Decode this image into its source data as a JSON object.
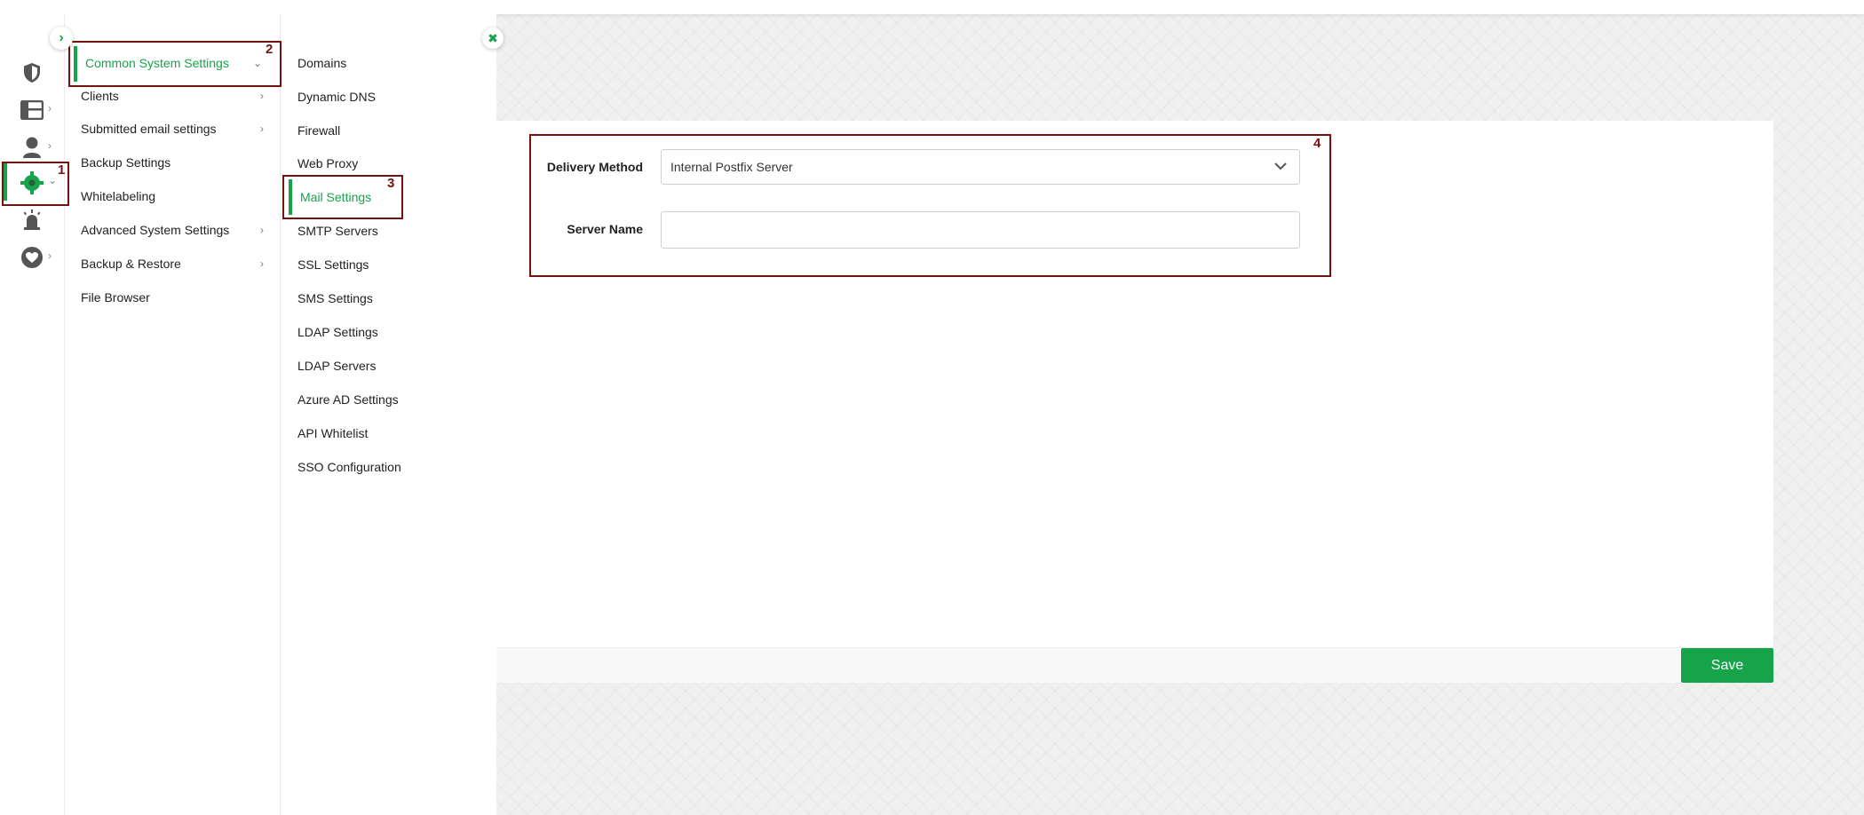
{
  "colors": {
    "accent": "#16a34a",
    "highlight": "#7a1111"
  },
  "rail": {
    "items": [
      {
        "icon": "shield-icon",
        "has_arrow": false
      },
      {
        "icon": "dashboard-icon",
        "has_arrow": true
      },
      {
        "icon": "user-icon",
        "has_arrow": true
      },
      {
        "icon": "settings-gear-icon",
        "has_arrow": true,
        "active": true
      },
      {
        "icon": "alarm-icon",
        "has_arrow": false
      },
      {
        "icon": "heart-icon",
        "has_arrow": true
      }
    ]
  },
  "menu1": {
    "items": [
      {
        "label": "Common System Settings",
        "arrow": "⌄",
        "active": true
      },
      {
        "label": "Clients",
        "arrow": "›"
      },
      {
        "label": "Submitted email settings",
        "arrow": "›"
      },
      {
        "label": "Backup Settings",
        "arrow": ""
      },
      {
        "label": "Whitelabeling",
        "arrow": ""
      },
      {
        "label": "Advanced System Settings",
        "arrow": "›"
      },
      {
        "label": "Backup & Restore",
        "arrow": "›"
      },
      {
        "label": "File Browser",
        "arrow": ""
      }
    ]
  },
  "menu2": {
    "items": [
      {
        "label": "Domains"
      },
      {
        "label": "Dynamic DNS"
      },
      {
        "label": "Firewall"
      },
      {
        "label": "Web Proxy"
      },
      {
        "label": "Mail Settings",
        "active": true
      },
      {
        "label": "SMTP Servers"
      },
      {
        "label": "SSL Settings"
      },
      {
        "label": "SMS Settings"
      },
      {
        "label": "LDAP Settings"
      },
      {
        "label": "LDAP Servers"
      },
      {
        "label": "Azure AD Settings"
      },
      {
        "label": "API Whitelist"
      },
      {
        "label": "SSO Configuration"
      }
    ]
  },
  "annotations": [
    "1",
    "2",
    "3",
    "4"
  ],
  "form": {
    "delivery_method_label": "Delivery Method",
    "delivery_method_value": "Internal Postfix Server",
    "server_name_label": "Server Name",
    "server_name_value": ""
  },
  "footer": {
    "save_label": "Save"
  }
}
